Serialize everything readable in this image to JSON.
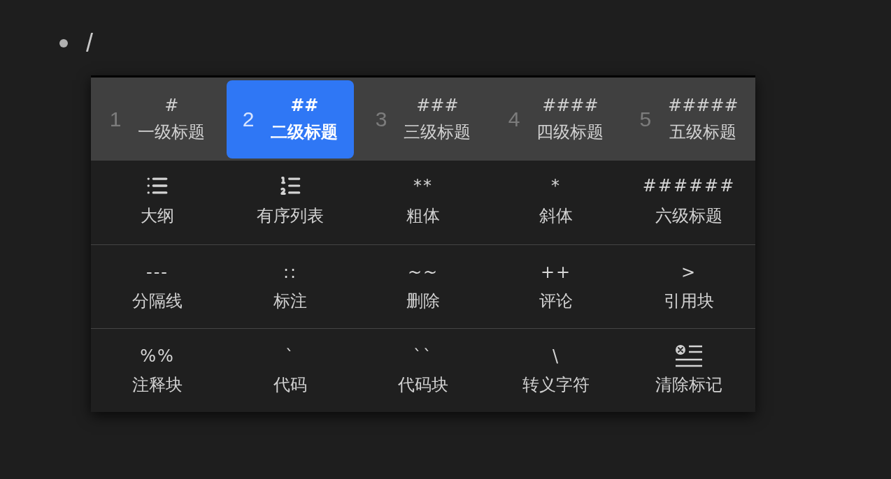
{
  "editor": {
    "text": "/"
  },
  "menu": {
    "headings": [
      {
        "number": "1",
        "symbol": "#",
        "label": "一级标题",
        "selected": false
      },
      {
        "number": "2",
        "symbol": "##",
        "label": "二级标题",
        "selected": true
      },
      {
        "number": "3",
        "symbol": "###",
        "label": "三级标题",
        "selected": false
      },
      {
        "number": "4",
        "symbol": "####",
        "label": "四级标题",
        "selected": false
      },
      {
        "number": "5",
        "symbol": "#####",
        "label": "五级标题",
        "selected": false
      }
    ],
    "rows": [
      {
        "items": [
          {
            "kind": "bullets",
            "label": "大纲"
          },
          {
            "kind": "numbers",
            "label": "有序列表"
          },
          {
            "kind": "symbol",
            "symbol": "**",
            "label": "粗体"
          },
          {
            "kind": "symbol",
            "symbol": "*",
            "label": "斜体"
          },
          {
            "kind": "symbol",
            "symbol": "######",
            "label": "六级标题"
          }
        ]
      },
      {
        "items": [
          {
            "kind": "symbol",
            "symbol": "---",
            "label": "分隔线"
          },
          {
            "kind": "symbol",
            "symbol": "::",
            "label": "标注"
          },
          {
            "kind": "symbol",
            "symbol": "~~",
            "label": "删除"
          },
          {
            "kind": "symbol",
            "symbol": "++",
            "label": "评论"
          },
          {
            "kind": "symbol",
            "symbol": ">",
            "label": "引用块"
          }
        ]
      },
      {
        "items": [
          {
            "kind": "symbol",
            "symbol": "%%",
            "label": "注释块"
          },
          {
            "kind": "symbol",
            "symbol": "`",
            "label": "代码"
          },
          {
            "kind": "symbol",
            "symbol": "``",
            "label": "代码块"
          },
          {
            "kind": "symbol",
            "symbol": "\\",
            "label": "转义字符"
          },
          {
            "kind": "clear",
            "label": "清除标记"
          }
        ]
      }
    ]
  }
}
